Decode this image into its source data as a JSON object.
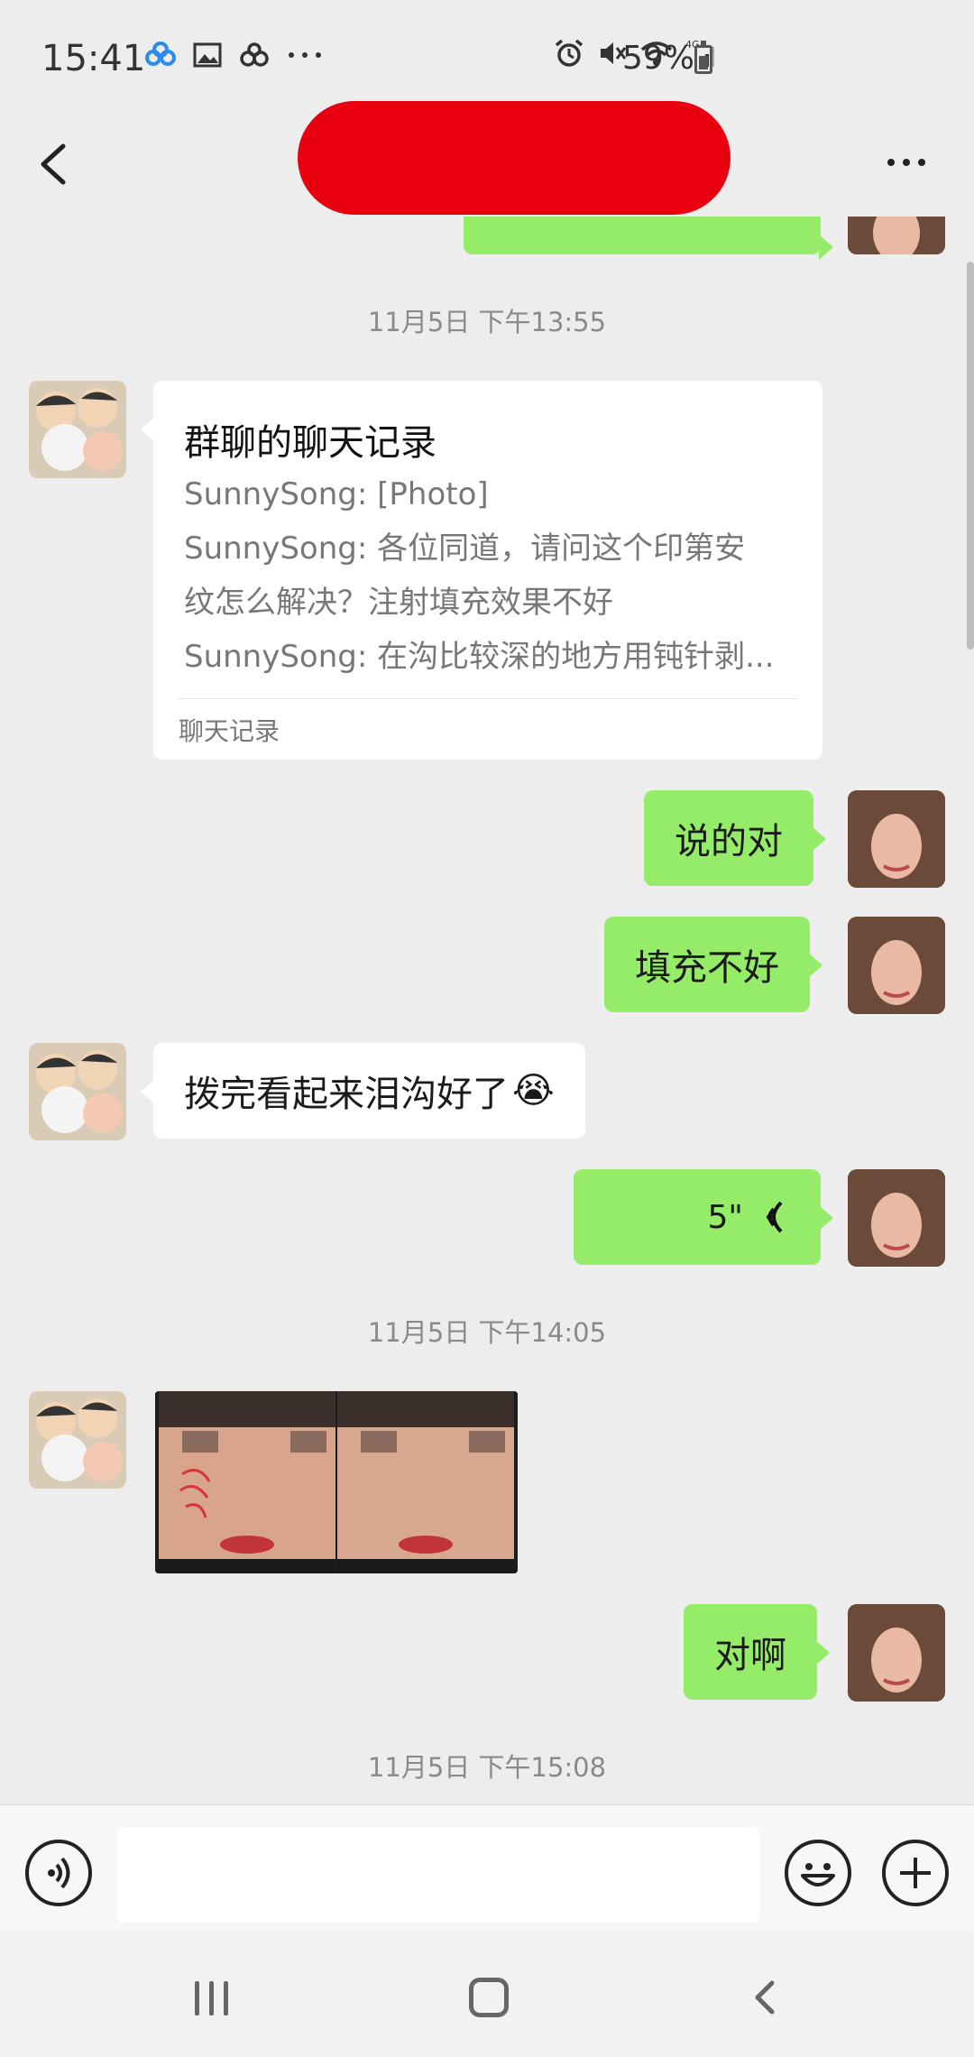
{
  "status_bar": {
    "time": "15:41",
    "battery": "59%",
    "icons_left": [
      "cloud-icon",
      "image-icon",
      "link-icon",
      "more-dots-icon"
    ],
    "icons_right": [
      "alarm-icon",
      "mute-icon",
      "wifi-icon",
      "signal-4g-icon",
      "battery-icon"
    ]
  },
  "nav": {
    "title_redacted": true,
    "back_icon": "chevron-left-icon",
    "more_icon": "more-dots-icon"
  },
  "timestamps": {
    "t1": "11月5日 下午13:55",
    "t2": "11月5日 下午14:05",
    "t3": "11月5日 下午15:08"
  },
  "chat_record": {
    "title": "群聊的聊天记录",
    "lines": [
      "SunnySong: [Photo]",
      "SunnySong: 各位同道，请问这个印第安",
      "纹怎么解决？注射填充效果不好",
      "SunnySong: 在沟比较深的地方用钝针剥..."
    ],
    "footer": "聊天记录"
  },
  "messages": {
    "m1": "说的对",
    "m2": "填充不好",
    "m3": "拨完看起来泪沟好了",
    "m3_emoji": "😭",
    "m4_voice_duration": "5\"",
    "m5": "对啊"
  },
  "colors": {
    "sent_bubble": "#95ec69",
    "received_bubble": "#ffffff",
    "background": "#ededed",
    "redaction": "#e8000f"
  }
}
